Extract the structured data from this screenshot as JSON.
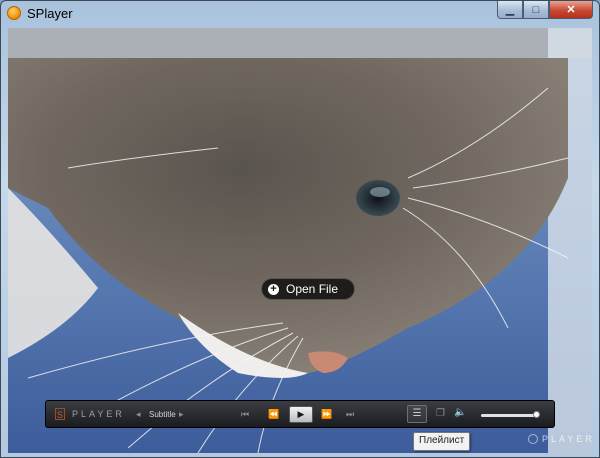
{
  "window": {
    "title": "SPlayer"
  },
  "window_controls": {
    "minimize": "▁",
    "maximize": "□",
    "close": "✕"
  },
  "overlay": {
    "open_file_label": "Open File"
  },
  "controls": {
    "logo_mark": "S",
    "logo_text": "PLAYER",
    "subtitle_prev": "◂",
    "subtitle_label": "Subtitle",
    "subtitle_next": "▸",
    "prev_track": "⏮",
    "rewind": "⏪",
    "play": "▶",
    "forward": "⏩",
    "next_track": "⏭",
    "playlist_icon": "☰",
    "screen_icon": "❐",
    "volume_icon": "🔈",
    "volume_level": 0.95
  },
  "tooltip": {
    "text": "Плейлист"
  },
  "watermark": {
    "text": "PLAYER"
  }
}
